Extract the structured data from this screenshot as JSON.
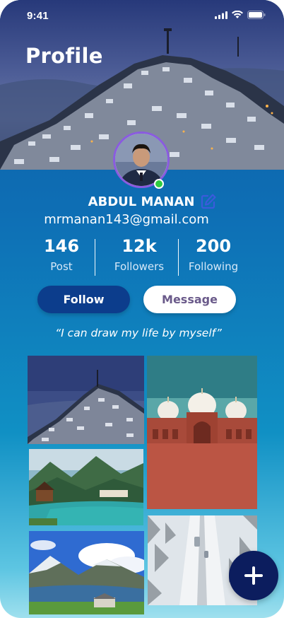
{
  "status_bar": {
    "time": "9:41",
    "icons": [
      "signal-icon",
      "wifi-icon",
      "battery-icon"
    ]
  },
  "header": {
    "title": "Profile"
  },
  "profile": {
    "name": "ABDUL MANAN",
    "email": "mrmanan143@gmail.com",
    "online": true,
    "quote": "“I can draw my life by myself”"
  },
  "stats": [
    {
      "value": "146",
      "label": "Post"
    },
    {
      "value": "12k",
      "label": "Followers"
    },
    {
      "value": "200",
      "label": "Following"
    }
  ],
  "actions": {
    "follow_label": "Follow",
    "message_label": "Message"
  },
  "gallery": [
    {
      "subject": "snowy hillside town at dusk"
    },
    {
      "subject": "red mosque with white domes"
    },
    {
      "subject": "turquoise river valley with chalets"
    },
    {
      "subject": "alpine lake with mountains and clouds"
    },
    {
      "subject": "snowy road through forest"
    }
  ],
  "colors": {
    "accent": "#0c3d8c",
    "fab": "#0c1d5e",
    "online": "#2ecc40",
    "avatar_ring": "#8a5be0",
    "message_text": "#6a5a8a"
  }
}
